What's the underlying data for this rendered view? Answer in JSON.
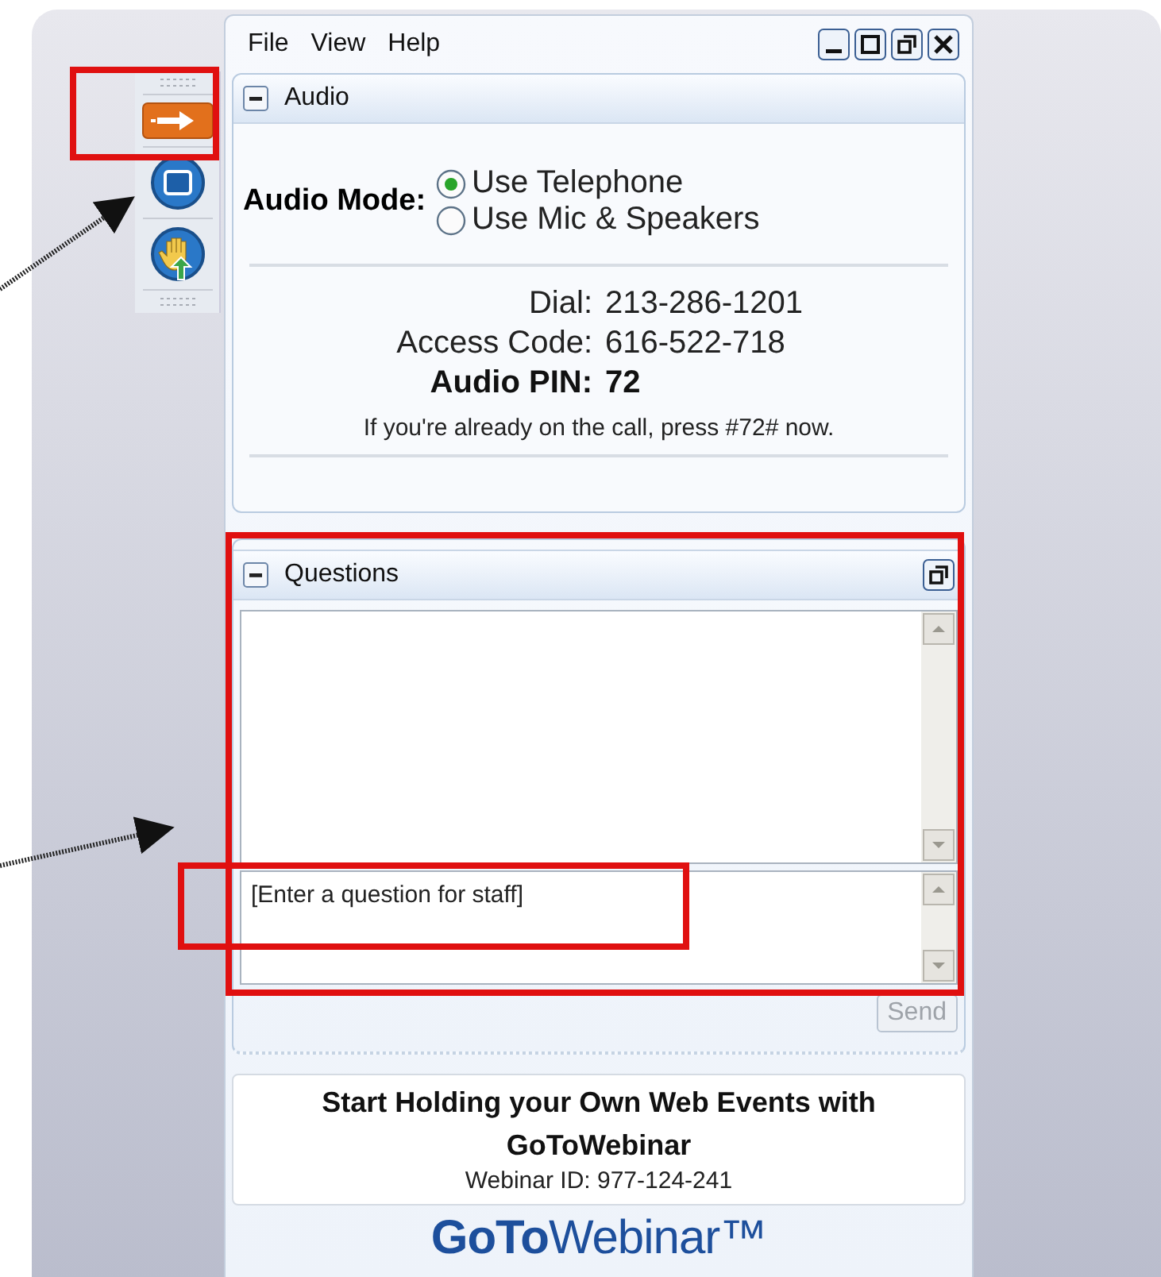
{
  "menu": [
    {
      "label": "File"
    },
    {
      "label": "View"
    },
    {
      "label": "Help"
    }
  ],
  "audio": {
    "title": "Audio",
    "mode_label": "Audio Mode:",
    "options": [
      {
        "label": "Use Telephone",
        "selected": true
      },
      {
        "label": "Use Mic & Speakers",
        "selected": false
      }
    ],
    "details": [
      {
        "label": "Dial:",
        "value": "213-286-1201",
        "emphasis": false
      },
      {
        "label": "Access Code:",
        "value": "616-522-718",
        "emphasis": false
      },
      {
        "label": "Audio PIN:",
        "value": "72",
        "emphasis": true
      }
    ],
    "note": "If you're already on the call, press #72# now."
  },
  "questions": {
    "title": "Questions",
    "placeholder": "[Enter a question for staff]",
    "send": {
      "label": "Send",
      "disabled": true
    }
  },
  "promo": {
    "headline": "Start Holding your Own Web Events with GoToWebinar",
    "webinar_id": "Webinar ID: 977-124-241"
  },
  "logo": "**GoTo**Webinar™"
}
